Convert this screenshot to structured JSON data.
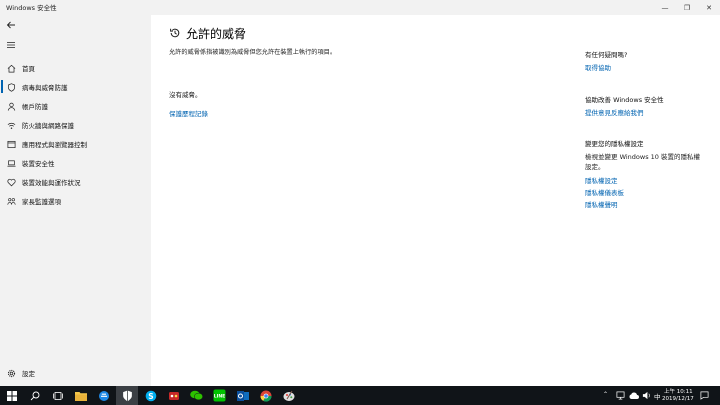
{
  "window": {
    "title": "Windows 安全性",
    "controls": {
      "minimize": "—",
      "restore": "❐",
      "close": "✕"
    }
  },
  "sidebar": {
    "back_icon": "back-arrow-icon",
    "menu_icon": "hamburger-icon",
    "items": [
      {
        "label": "首頁",
        "icon": "home-icon"
      },
      {
        "label": "病毒與威脅防護",
        "icon": "shield-icon",
        "active": true
      },
      {
        "label": "帳戶防護",
        "icon": "person-icon"
      },
      {
        "label": "防火牆與網路保護",
        "icon": "wifi-icon"
      },
      {
        "label": "應用程式與瀏覽器控制",
        "icon": "app-window-icon"
      },
      {
        "label": "裝置安全性",
        "icon": "laptop-icon"
      },
      {
        "label": "裝置效能與運作狀況",
        "icon": "heart-icon"
      },
      {
        "label": "家長監護選項",
        "icon": "family-icon"
      }
    ],
    "settings": {
      "label": "設定",
      "icon": "gear-icon"
    }
  },
  "main": {
    "title": "允許的威脅",
    "description": "允許的威脅係指被識別為威脅但您允許在裝置上執行的項目。",
    "status": "沒有威脅。",
    "history_link": "保護歷程記錄"
  },
  "right_panel": {
    "question_heading": "有任何疑問嗎?",
    "get_help_link": "取得協助",
    "improve_heading": "協助改善 Windows 安全性",
    "feedback_link": "提供意見反應給我們",
    "privacy_heading": "變更您的隱私權設定",
    "privacy_desc": "檢視並變更 Windows 10 裝置的隱私權設定。",
    "privacy_links": [
      "隱私權設定",
      "隱私權儀表板",
      "隱私權聲明"
    ]
  },
  "taskbar": {
    "time": "上午 10:11",
    "date": "2019/12/17",
    "ime": "中"
  },
  "colors": {
    "accent": "#0063b1",
    "sidebar_bg": "#f2f2f2",
    "taskbar_bg": "#101418"
  }
}
